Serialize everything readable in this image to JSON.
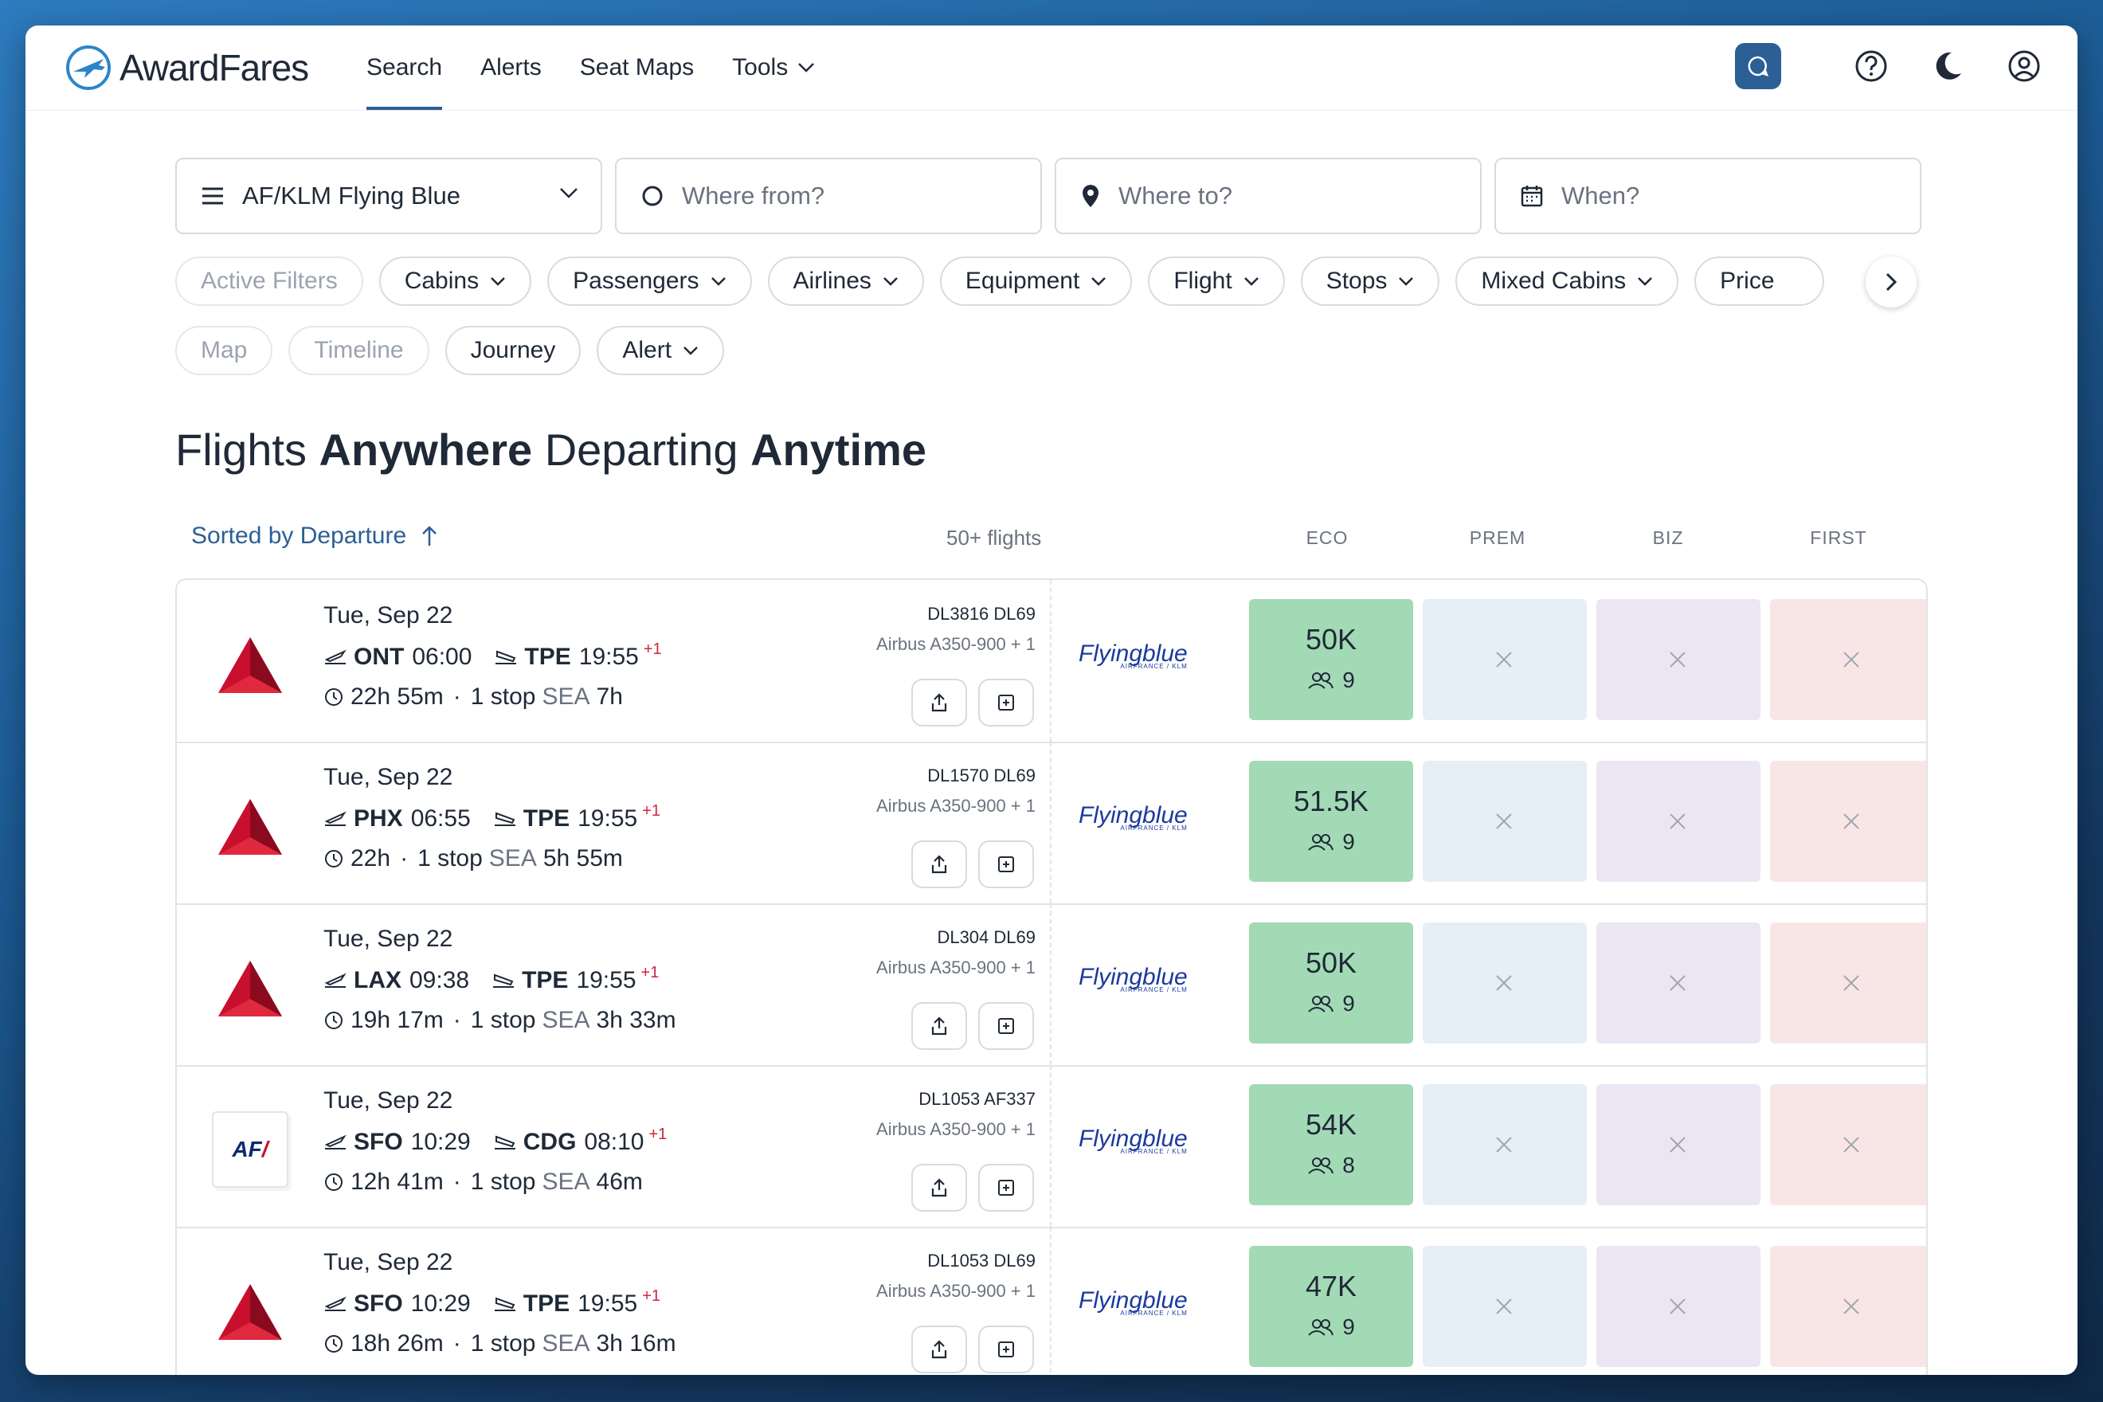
{
  "app": {
    "brand_a": "Award",
    "brand_b": "Fares"
  },
  "nav": {
    "search": "Search",
    "alerts": "Alerts",
    "seat_maps": "Seat Maps",
    "tools": "Tools"
  },
  "search": {
    "program": "AF/KLM Flying Blue",
    "from_placeholder": "Where from?",
    "to_placeholder": "Where to?",
    "when_placeholder": "When?"
  },
  "filters": {
    "active": "Active Filters",
    "cabins": "Cabins",
    "passengers": "Passengers",
    "airlines": "Airlines",
    "equipment": "Equipment",
    "flight": "Flight",
    "stops": "Stops",
    "mixed_cabins": "Mixed Cabins",
    "price": "Price",
    "map": "Map",
    "timeline": "Timeline",
    "journey": "Journey",
    "alert": "Alert"
  },
  "heading": {
    "p1": "Flights ",
    "p2": "Anywhere",
    "p3": " Departing ",
    "p4": "Anytime"
  },
  "list": {
    "sorted": "Sorted by Departure",
    "count": "50+ flights",
    "cols": {
      "eco": "ECO",
      "prem": "PREM",
      "biz": "BIZ",
      "first": "FIRST"
    }
  },
  "program_logo": "Flyingblue",
  "program_logo_sub": "AIRFRANCE / KLM",
  "colors": {
    "accent": "#2b5f95",
    "eco": "#a3dab6",
    "prem": "#e6eef6",
    "biz": "#ece6f4",
    "first": "#f8e6e7",
    "delta": "#c8102e"
  },
  "flights": [
    {
      "airline": "delta",
      "date": "Tue, Sep 22",
      "from": "ONT",
      "dep": "06:00",
      "to": "TPE",
      "arr": "19:55",
      "plus": "+1",
      "duration": "22h 55m",
      "stops": "1 stop",
      "via": "SEA",
      "layover": "7h",
      "flight_nos": "DL3816  DL69",
      "equipment": "Airbus A350-900 + 1",
      "eco_price": "50K",
      "eco_seats": "9"
    },
    {
      "airline": "delta",
      "date": "Tue, Sep 22",
      "from": "PHX",
      "dep": "06:55",
      "to": "TPE",
      "arr": "19:55",
      "plus": "+1",
      "duration": "22h",
      "stops": "1 stop",
      "via": "SEA",
      "layover": "5h 55m",
      "flight_nos": "DL1570  DL69",
      "equipment": "Airbus A350-900 + 1",
      "eco_price": "51.5K",
      "eco_seats": "9"
    },
    {
      "airline": "delta",
      "date": "Tue, Sep 22",
      "from": "LAX",
      "dep": "09:38",
      "to": "TPE",
      "arr": "19:55",
      "plus": "+1",
      "duration": "19h 17m",
      "stops": "1 stop",
      "via": "SEA",
      "layover": "3h 33m",
      "flight_nos": "DL304  DL69",
      "equipment": "Airbus A350-900 + 1",
      "eco_price": "50K",
      "eco_seats": "9"
    },
    {
      "airline": "airfrance",
      "airline_text": "AF",
      "date": "Tue, Sep 22",
      "from": "SFO",
      "dep": "10:29",
      "to": "CDG",
      "arr": "08:10",
      "plus": "+1",
      "duration": "12h 41m",
      "stops": "1 stop",
      "via": "SEA",
      "layover": "46m",
      "flight_nos": "DL1053  AF337",
      "equipment": "Airbus A350-900 + 1",
      "eco_price": "54K",
      "eco_seats": "8"
    },
    {
      "airline": "delta",
      "date": "Tue, Sep 22",
      "from": "SFO",
      "dep": "10:29",
      "to": "TPE",
      "arr": "19:55",
      "plus": "+1",
      "duration": "18h 26m",
      "stops": "1 stop",
      "via": "SEA",
      "layover": "3h 16m",
      "flight_nos": "DL1053  DL69",
      "equipment": "Airbus A350-900 + 1",
      "eco_price": "47K",
      "eco_seats": "9"
    }
  ]
}
